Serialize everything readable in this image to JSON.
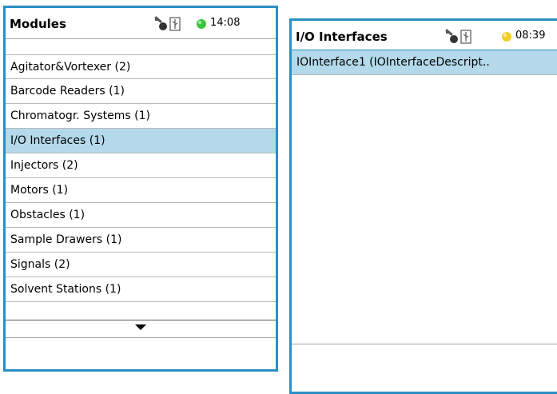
{
  "left_screen": {
    "title": "Modules",
    "time": "14:08",
    "status_color": "#3cc43c",
    "items": [
      {
        "label": "Agitator&Vortexer (2)",
        "selected": false
      },
      {
        "label": "Barcode Readers (1)",
        "selected": false
      },
      {
        "label": "Chromatogr. Systems (1)",
        "selected": false
      },
      {
        "label": "I/O Interfaces (1)",
        "selected": true
      },
      {
        "label": "Injectors (2)",
        "selected": false
      },
      {
        "label": "Motors (1)",
        "selected": false
      },
      {
        "label": "Obstacles (1)",
        "selected": false
      },
      {
        "label": "Sample Drawers (1)",
        "selected": false
      },
      {
        "label": "Signals (2)",
        "selected": false
      },
      {
        "label": "Solvent Stations (1)",
        "selected": false
      }
    ],
    "scroll_icon": "triangle-down-icon"
  },
  "right_screen": {
    "title": "I/O Interfaces",
    "time": "08:39",
    "status_color": "#f2cc2a",
    "items": [
      {
        "label": "IOInterface1 (IOInterfaceDescript..",
        "selected": true
      }
    ]
  },
  "icons": {
    "key": "key-icon",
    "usb": "usb-icon",
    "status": "status-led-icon"
  },
  "colors": {
    "frame": "#2a8fc4",
    "selection": "#b3d9ea"
  }
}
